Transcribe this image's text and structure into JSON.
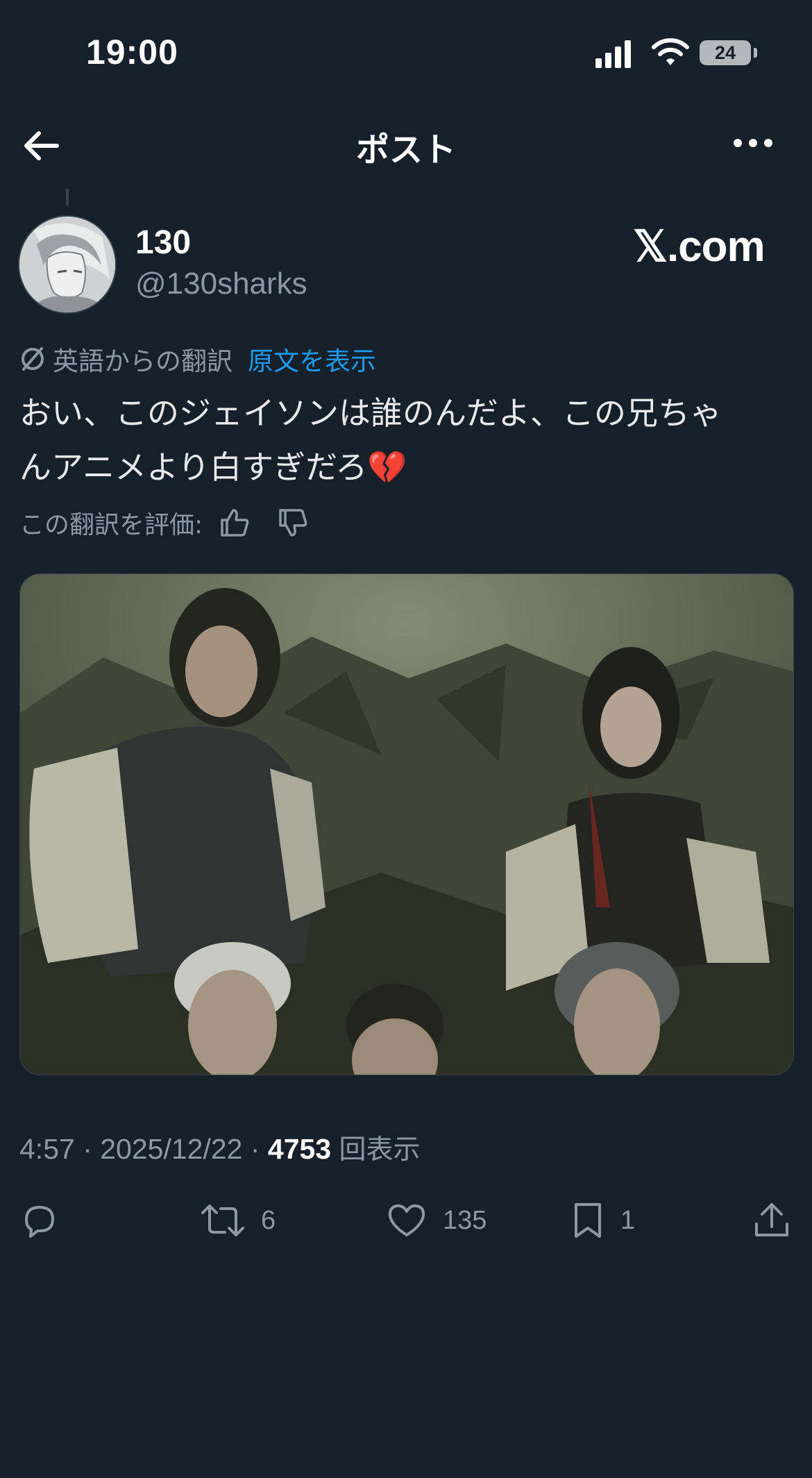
{
  "status_bar": {
    "time": "19:00",
    "battery": "24"
  },
  "nav": {
    "title": "ポスト"
  },
  "post": {
    "author": {
      "display_name": "130",
      "handle": "@130sharks"
    },
    "watermark": "𝕏.com",
    "translation": {
      "label": "英語からの翻訳",
      "show_original": "原文を表示",
      "rate_label": "この翻訳を評価:"
    },
    "text": "おい、このジェイソンは誰のんだよ、この兄ちゃ\nんアニメより白すぎだろ💔",
    "meta": {
      "time": "4:57",
      "date": "2025/12/22",
      "views": "4753",
      "views_label": "回表示"
    },
    "actions": {
      "retweets": "6",
      "likes": "135",
      "bookmarks": "1"
    }
  },
  "icons": {
    "back": "arrow-left-icon",
    "more": "more-horizontal-icon",
    "translate": "translate-icon",
    "thumbs_up": "thumbs-up-icon",
    "thumbs_down": "thumbs-down-icon",
    "reply": "reply-icon",
    "retweet": "retweet-icon",
    "like": "heart-icon",
    "bookmark": "bookmark-icon",
    "share": "share-icon"
  },
  "colors": {
    "background": "#15202b",
    "accent": "#1d9bf0",
    "secondary_text": "#8b98a5"
  }
}
